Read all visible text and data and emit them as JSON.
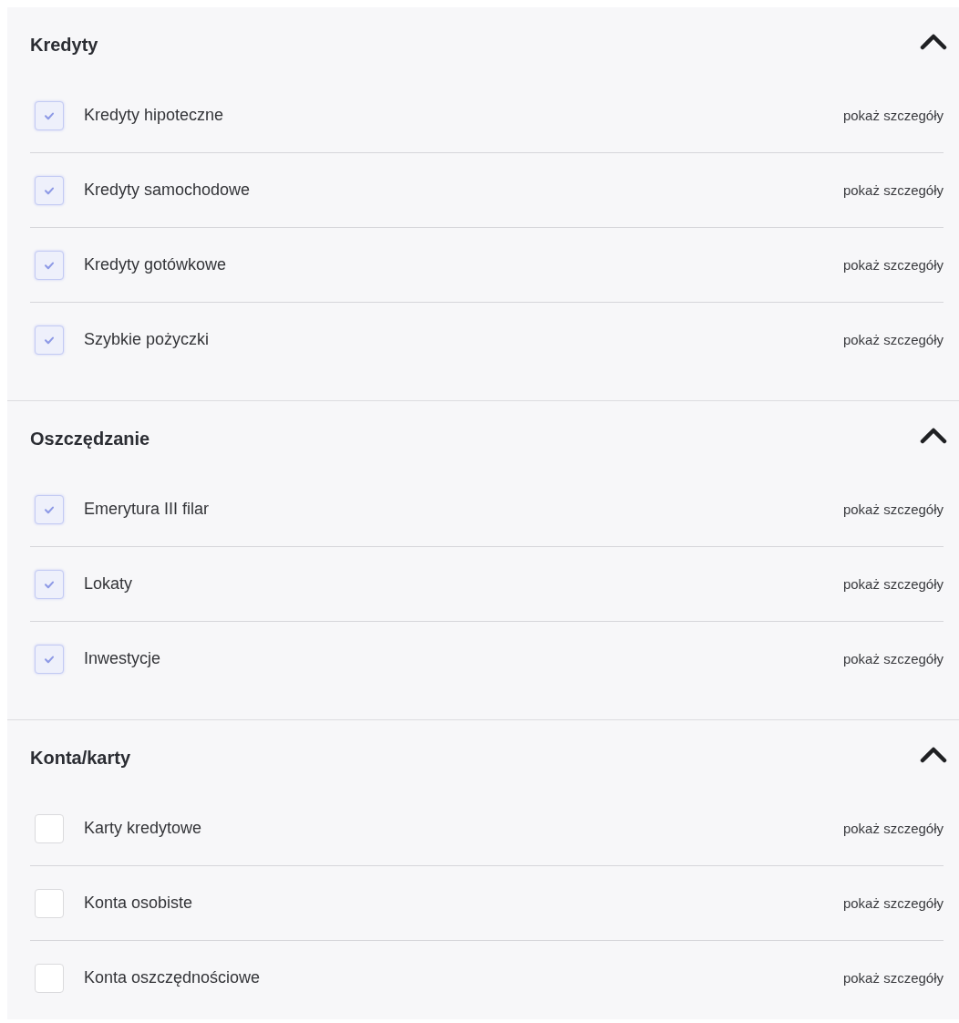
{
  "sections": [
    {
      "title": "Kredyty",
      "expanded": true,
      "items": [
        {
          "label": "Kredyty hipoteczne",
          "checked": true,
          "link": "pokaż szczegóły"
        },
        {
          "label": "Kredyty samochodowe",
          "checked": true,
          "link": "pokaż szczegóły"
        },
        {
          "label": "Kredyty gotówkowe",
          "checked": true,
          "link": "pokaż szczegóły"
        },
        {
          "label": "Szybkie pożyczki",
          "checked": true,
          "link": "pokaż szczegóły"
        }
      ]
    },
    {
      "title": "Oszczędzanie",
      "expanded": true,
      "items": [
        {
          "label": "Emerytura III filar",
          "checked": true,
          "link": "pokaż szczegóły"
        },
        {
          "label": "Lokaty",
          "checked": true,
          "link": "pokaż szczegóły"
        },
        {
          "label": "Inwestycje",
          "checked": true,
          "link": "pokaż szczegóły"
        }
      ]
    },
    {
      "title": "Konta/karty",
      "expanded": true,
      "items": [
        {
          "label": "Karty kredytowe",
          "checked": false,
          "link": "pokaż szczegóły"
        },
        {
          "label": "Konta osobiste",
          "checked": false,
          "link": "pokaż szczegóły"
        },
        {
          "label": "Konta oszczędnościowe",
          "checked": false,
          "link": "pokaż szczegóły"
        }
      ]
    }
  ]
}
